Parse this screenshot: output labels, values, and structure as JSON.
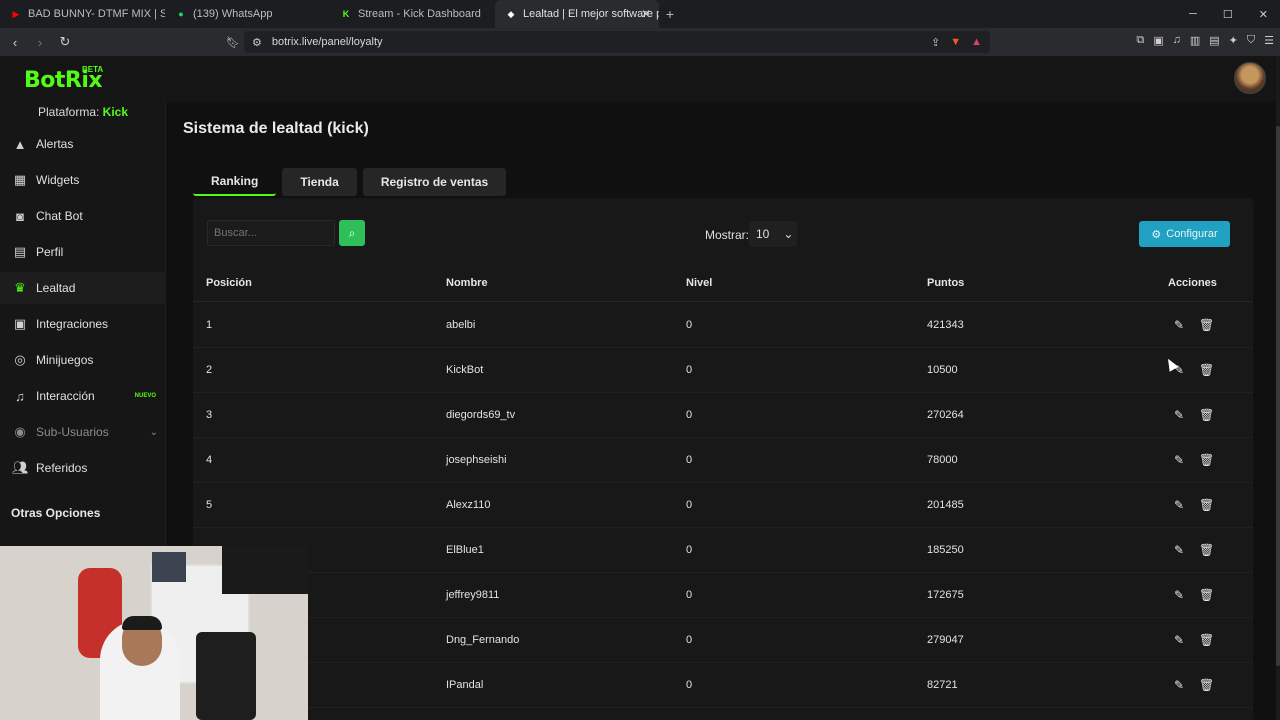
{
  "browser": {
    "tabs": [
      {
        "title": "BAD BUNNY- DTMF MIX | STACK",
        "icon": "youtube-icon",
        "color": "#ff0000"
      },
      {
        "title": "(139) WhatsApp",
        "icon": "whatsapp-icon",
        "color": "#25d366"
      },
      {
        "title": "Stream - Kick Dashboard",
        "icon": "kick-icon",
        "color": "#53fc18"
      },
      {
        "title": "Lealtad | El mejor software para",
        "icon": "botrix-icon",
        "color": "#ffffff"
      }
    ],
    "url": "botrix.live/panel/loyalty"
  },
  "app": {
    "logo": "BotRix",
    "logo_badge": "BETA",
    "platform_label": "Plataforma:",
    "platform_value": "Kick"
  },
  "sidebar": {
    "items": [
      {
        "label": "Alertas",
        "icon": "warning-icon"
      },
      {
        "label": "Widgets",
        "icon": "widgets-icon"
      },
      {
        "label": "Chat Bot",
        "icon": "robot-icon"
      },
      {
        "label": "Perfil",
        "icon": "profile-card-icon"
      },
      {
        "label": "Lealtad",
        "icon": "trophy-icon"
      },
      {
        "label": "Integraciones",
        "icon": "integrations-icon"
      },
      {
        "label": "Minijuegos",
        "icon": "gamepad-icon"
      },
      {
        "label": "Interacción",
        "icon": "music-icon",
        "badge": "NUEVO"
      },
      {
        "label": "Sub-Usuarios",
        "icon": "users-icon"
      },
      {
        "label": "Referidos",
        "icon": "referrals-icon"
      }
    ],
    "section_title": "Otras Opciones"
  },
  "main": {
    "title": "Sistema de lealtad (kick)",
    "tabs": [
      "Ranking",
      "Tienda",
      "Registro de ventas"
    ],
    "search_placeholder": "Buscar...",
    "show_label": "Mostrar:",
    "show_value": "10",
    "config_label": "Configurar",
    "columns": [
      "Posición",
      "Nombre",
      "Nivel",
      "Puntos",
      "Acciones"
    ],
    "rows": [
      {
        "pos": "1",
        "name": "abelbi",
        "level": "0",
        "points": "421343"
      },
      {
        "pos": "2",
        "name": "KickBot",
        "level": "0",
        "points": "10500"
      },
      {
        "pos": "3",
        "name": "diegords69_tv",
        "level": "0",
        "points": "270264"
      },
      {
        "pos": "4",
        "name": "josephseishi",
        "level": "0",
        "points": "78000"
      },
      {
        "pos": "5",
        "name": "Alexz110",
        "level": "0",
        "points": "201485"
      },
      {
        "pos": "",
        "name": "ElBlue1",
        "level": "0",
        "points": "185250"
      },
      {
        "pos": "",
        "name": "jeffrey9811",
        "level": "0",
        "points": "172675"
      },
      {
        "pos": "",
        "name": "Dng_Fernando",
        "level": "0",
        "points": "279047"
      },
      {
        "pos": "",
        "name": "IPandal",
        "level": "0",
        "points": "82721"
      }
    ]
  },
  "colors": {
    "accent": "#53fc18",
    "config": "#20a1c2",
    "search": "#2fbf5a"
  }
}
